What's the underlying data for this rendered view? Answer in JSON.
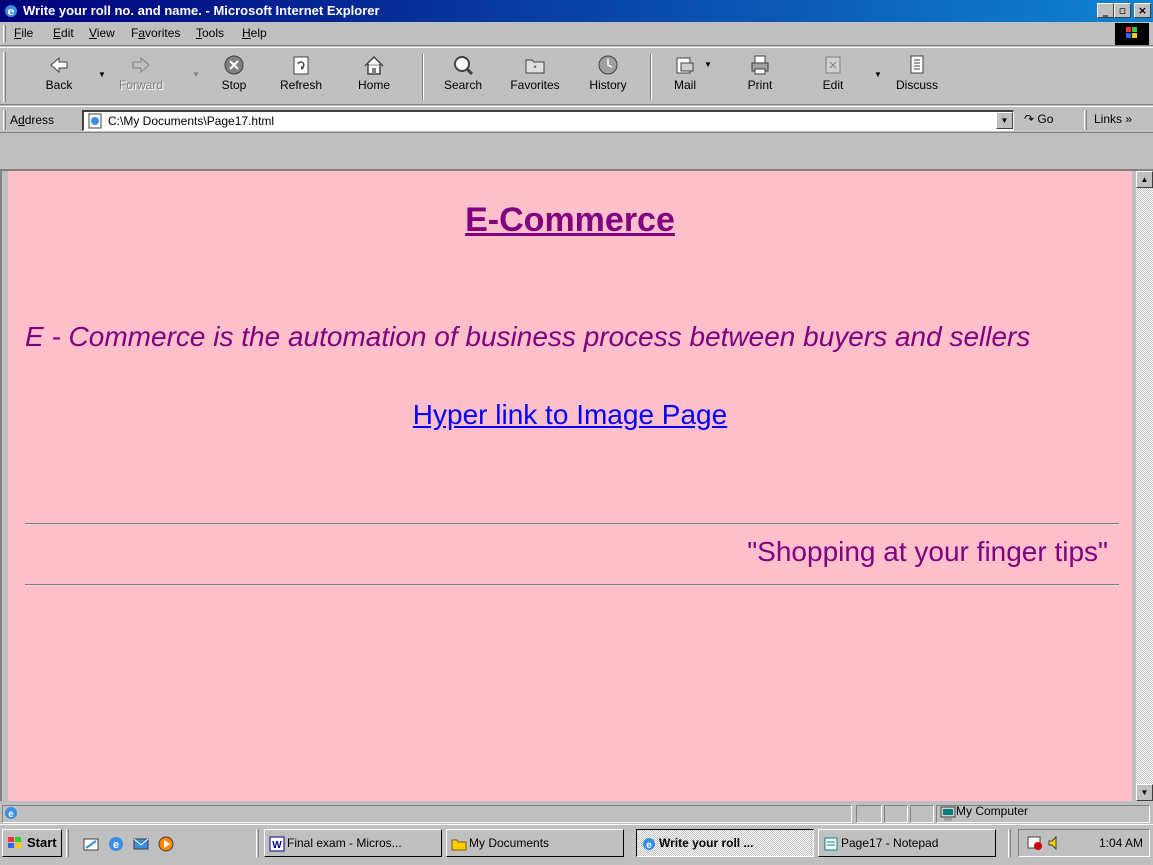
{
  "window": {
    "title": "Write your roll no. and name. - Microsoft Internet Explorer",
    "controls": [
      "_",
      "▫",
      "×"
    ]
  },
  "menu": {
    "items": [
      {
        "u": "F",
        "rest": "ile"
      },
      {
        "u": "E",
        "rest": "dit"
      },
      {
        "u": "V",
        "rest": "iew"
      },
      {
        "pre": "F",
        "u": "a",
        "rest": "vorites"
      },
      {
        "u": "T",
        "rest": "ools"
      },
      {
        "u": "H",
        "rest": "elp"
      }
    ]
  },
  "toolbar": {
    "back": "Back",
    "forward": "Forward",
    "stop": "Stop",
    "refresh": "Refresh",
    "home": "Home",
    "search": "Search",
    "favorites": "Favorites",
    "history": "History",
    "mail": "Mail",
    "print": "Print",
    "edit": "Edit",
    "discuss": "Discuss"
  },
  "address": {
    "label_pre": "A",
    "label_u": "d",
    "label_rest": "dress",
    "value": "C:\\My Documents\\Page17.html",
    "go": "Go",
    "links": "Links »"
  },
  "page": {
    "background": "#ffc0cb",
    "heading": "E-Commerce",
    "paragraph": "E - Commerce is the automation of business process between buyers and sellers",
    "link_text": "Hyper link to Image Page",
    "slogan": "\"Shopping at your finger tips\"",
    "text_color": "#800080",
    "link_color": "#0000ff"
  },
  "status": {
    "zone": "My Computer"
  },
  "taskbar": {
    "start": "Start",
    "buttons": [
      {
        "label": "Final exam - Micros...",
        "active": false
      },
      {
        "label": "My Documents",
        "active": false
      },
      {
        "label": "Write your roll ...",
        "active": true
      },
      {
        "label": "Page17 - Notepad",
        "active": false
      }
    ],
    "clock": "1:04 AM"
  }
}
